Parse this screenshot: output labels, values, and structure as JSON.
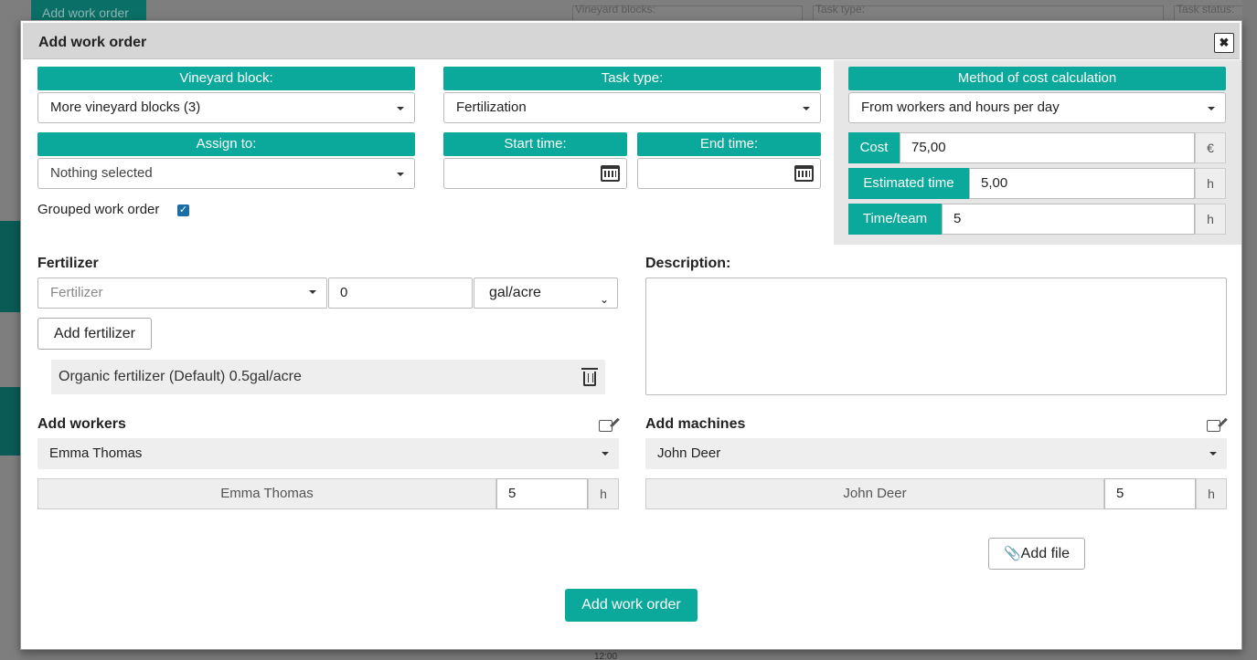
{
  "background": {
    "add_work_order_button": "Add work order",
    "filter_labels": [
      "Vineyard blocks:",
      "Task type:",
      "Task status:"
    ],
    "time_label": "12:00"
  },
  "modal": {
    "title": "Add work order",
    "close_symbol": "✖",
    "vineyard_block": {
      "label": "Vineyard block:",
      "value": "More vineyard blocks (3)"
    },
    "task_type": {
      "label": "Task type:",
      "value": "Fertilization"
    },
    "assign_to": {
      "label": "Assign to:",
      "value": "Nothing selected"
    },
    "start_time": {
      "label": "Start time:",
      "value": ""
    },
    "end_time": {
      "label": "End time:",
      "value": ""
    },
    "grouped": {
      "label": "Grouped work order",
      "checked": true
    },
    "cost_method": {
      "label": "Method of cost calculation",
      "value": "From workers and hours per day",
      "cost_label": "Cost",
      "cost_value": "75,00",
      "cost_unit": "€",
      "est_label": "Estimated time",
      "est_value": "5,00",
      "est_unit": "h",
      "team_label": "Time/team",
      "team_value": "5",
      "team_unit": "h"
    },
    "fertilizer": {
      "title": "Fertilizer",
      "placeholder": "Fertilizer",
      "amount": "0",
      "unit": "gal/acre",
      "add_button": "Add fertilizer",
      "items": [
        {
          "text": "Organic fertilizer (Default) 0.5gal/acre"
        }
      ]
    },
    "description": {
      "title": "Description:",
      "value": ""
    },
    "workers": {
      "title": "Add workers",
      "selected": "Emma Thomas",
      "rows": [
        {
          "name": "Emma Thomas",
          "hours": "5",
          "unit": "h"
        }
      ]
    },
    "machines": {
      "title": "Add machines",
      "selected": "John Deer",
      "rows": [
        {
          "name": "John Deer",
          "hours": "5",
          "unit": "h"
        }
      ]
    },
    "add_file_button": "Add file",
    "submit_button": "Add work order"
  },
  "colors": {
    "accent": "#0aa99c",
    "header": "#d6d6d6"
  },
  "icons": [
    "close-icon",
    "calendar-icon",
    "chevron-down-icon",
    "trash-icon",
    "edit-icon",
    "paperclip-icon",
    "checkbox-checked-icon"
  ]
}
